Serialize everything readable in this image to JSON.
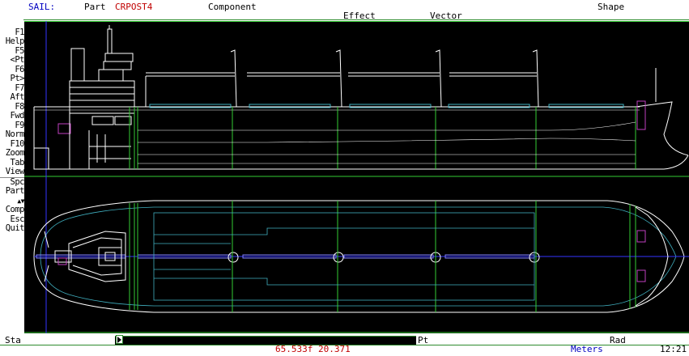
{
  "app": {
    "title": "SAIL:",
    "part_label": "Part",
    "part_name": "CRPOST4",
    "menu_component": "Component",
    "menu_effect": "Effect",
    "menu_vector": "Vector",
    "menu_shape": "Shape"
  },
  "function_keys": [
    {
      "key": "F1",
      "label": "Help"
    },
    {
      "key": "F5",
      "label": "<Pt"
    },
    {
      "key": "F6",
      "label": "Pt>"
    },
    {
      "key": "F7",
      "label": "Aft"
    },
    {
      "key": "F8",
      "label": "Fwd"
    },
    {
      "key": "F9",
      "label": "Norm"
    },
    {
      "key": "F10",
      "label": "Zoom"
    },
    {
      "key": "Tab",
      "label": "View"
    },
    {
      "key": "Spc",
      "label": "Part"
    },
    {
      "key": "▲▼",
      "label": "Comp"
    },
    {
      "key": "Esc",
      "label": "Quit"
    }
  ],
  "status": {
    "sta_label": "Sta",
    "pt_label": "Pt",
    "rad_label": "Rad",
    "coords": "65.533f 20.371",
    "units": "Meters",
    "clock": "12:21"
  },
  "colors": {
    "accent_red": "#c00000",
    "title_blue": "#0000c0",
    "hull_white": "#ffffff",
    "frame_green": "#33cc33",
    "deck_cyan": "#40b0c0",
    "highlight_magenta": "#c040c0",
    "centerline_blue": "#3333ff",
    "canvas_bg": "#000000"
  }
}
